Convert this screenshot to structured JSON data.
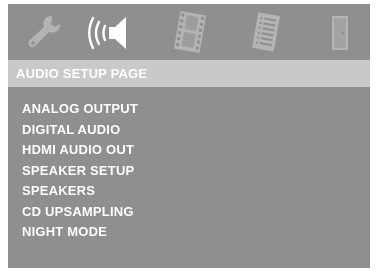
{
  "icons": [
    {
      "name": "wrench-icon",
      "selected": false
    },
    {
      "name": "speaker-icon",
      "selected": true
    },
    {
      "name": "film-icon",
      "selected": false
    },
    {
      "name": "document-icon",
      "selected": false
    },
    {
      "name": "door-icon",
      "selected": false
    }
  ],
  "page_title": "AUDIO SETUP PAGE",
  "menu": {
    "items": [
      {
        "label": "ANALOG OUTPUT"
      },
      {
        "label": "DIGITAL AUDIO"
      },
      {
        "label": "HDMI AUDIO OUT"
      },
      {
        "label": "SPEAKER SETUP"
      },
      {
        "label": "SPEAKERS"
      },
      {
        "label": "CD UPSAMPLING"
      },
      {
        "label": "NIGHT MODE"
      }
    ]
  },
  "colors": {
    "background": "#8f8f8f",
    "title_bar": "#c9c9c9",
    "text": "#ffffff",
    "icon_dim": "#b4b4b4",
    "icon_selected": "#ffffff"
  }
}
